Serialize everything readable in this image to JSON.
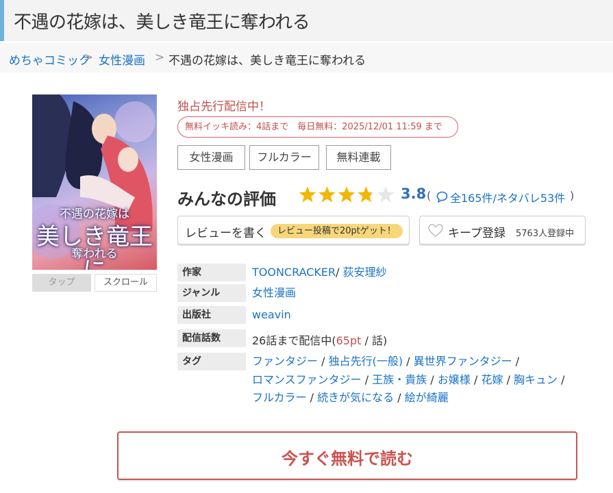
{
  "page": {
    "title": "不遇の花嫁は、美しき竜王に奪われる"
  },
  "breadcrumb": {
    "home": "めちゃコミック",
    "category": "女性漫画",
    "current": "不遇の花嫁は、美しき竜王に奪われる",
    "separator": ">"
  },
  "cover": {
    "title_line1": "不遇の花嫁は",
    "title_line2": "美しき竜王に",
    "title_line3": "奪われる",
    "tap_label": "タップ",
    "scroll_label": "スクロール"
  },
  "promo": {
    "exclusive": "独占先行配信中！",
    "free_info": "無料イッキ読み：4話まで　毎日無料：2025/12/01 11:59 まで"
  },
  "genre_tags": [
    "女性漫画",
    "フルカラー",
    "無料連載"
  ],
  "rating": {
    "label": "みんなの評価",
    "score": "3.8",
    "stars_value": 3.8,
    "stars_max": 5,
    "open_paren": "(",
    "reviews": "全165件/ネタバレ53件",
    "close_paren": ")",
    "star_color": "#f2b705"
  },
  "review_button": {
    "label": "レビューを書く",
    "badge": "レビュー投稿で20ptゲット！"
  },
  "keep_button": {
    "label": "キープ登録",
    "count": "5763人登録中"
  },
  "info": {
    "author_label": "作家",
    "author1": "TOONCRACKER",
    "author_sep": "/",
    "author2": "荻安理紗",
    "genre_label": "ジャンル",
    "genre": "女性漫画",
    "publisher_label": "出版社",
    "publisher": "weavin",
    "episodes_label": "配信話数",
    "episodes_pre": "26話まで配信中(",
    "episodes_price": "65pt",
    "episodes_post": " / 話)",
    "tags_label": "タグ",
    "tags": [
      "ファンタジー",
      "独占先行(一般)",
      "異世界ファンタジー",
      "ロマンスファンタジー",
      "王族・貴族",
      "お嬢様",
      "花嫁",
      "胸キュン",
      "フルカラー",
      "続きが気になる",
      "絵が綺麗"
    ],
    "tag_sep": "/"
  },
  "cta": {
    "label": "今すぐ無料で読む"
  },
  "colors": {
    "accent_red": "#c9534f",
    "link_blue": "#1a73c8",
    "title_bar_accent": "#6fb3d9"
  }
}
